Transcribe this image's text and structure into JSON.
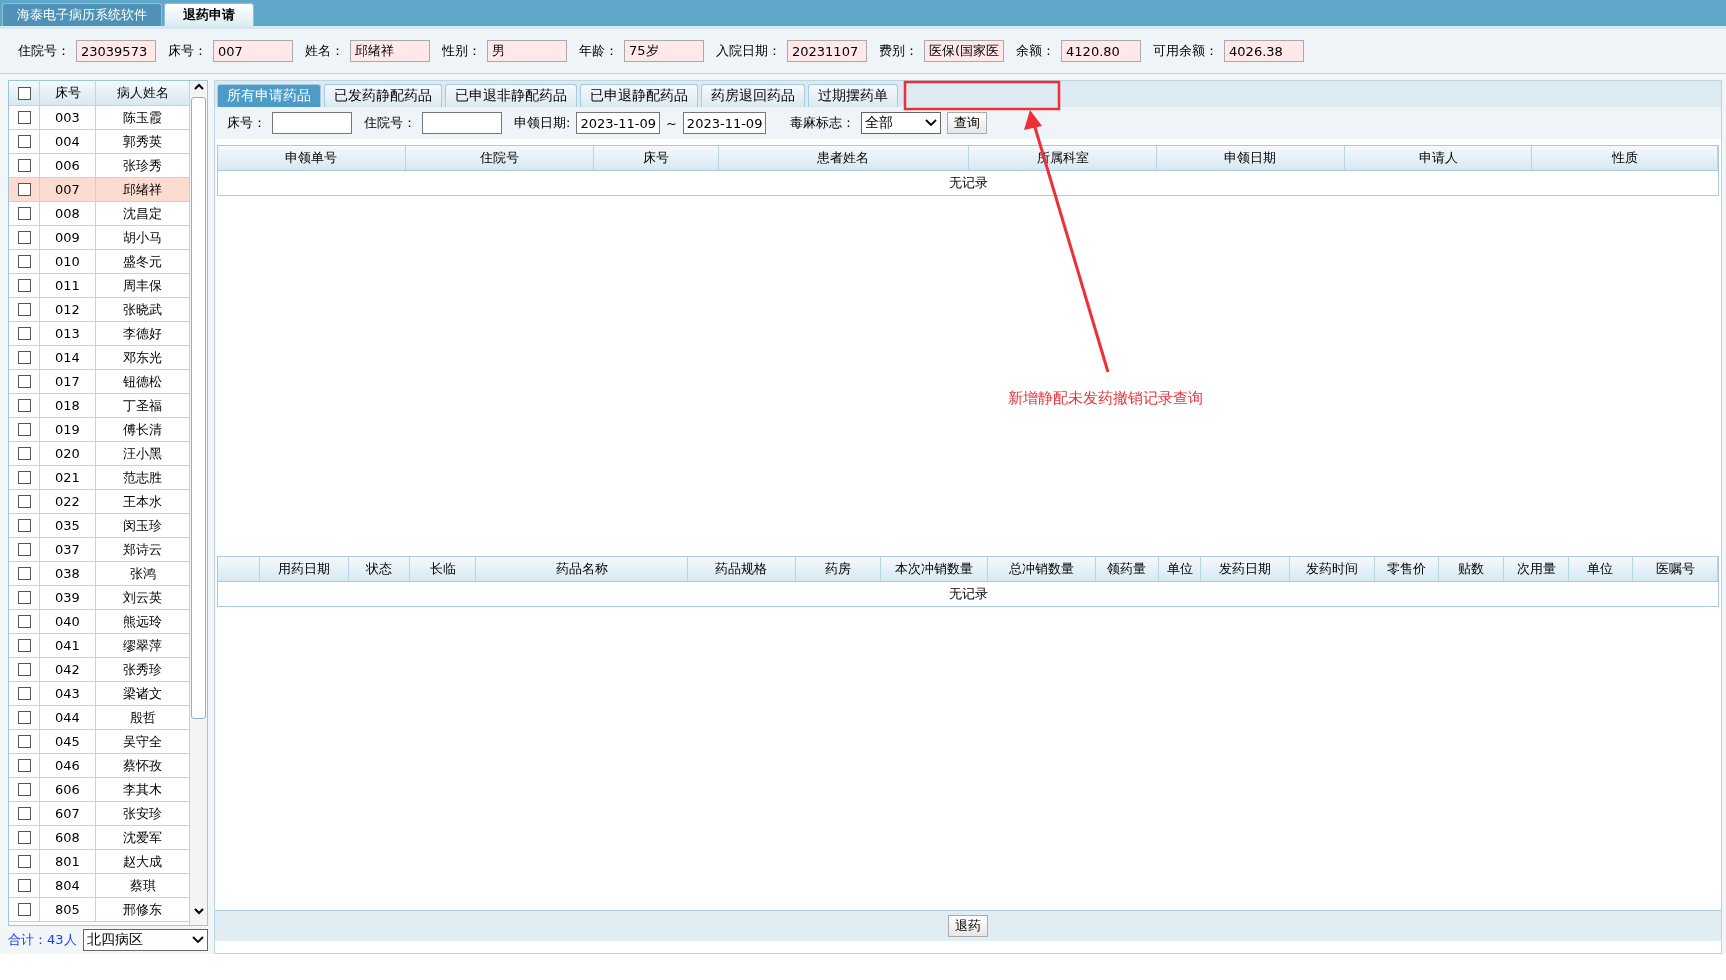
{
  "window_tabs": [
    {
      "label": "海泰电子病历系统软件",
      "selected": false
    },
    {
      "label": "退药申请",
      "selected": true
    }
  ],
  "patient_info": [
    {
      "label": "住院号：",
      "value": "23039573"
    },
    {
      "label": "床号：",
      "value": "007"
    },
    {
      "label": "姓名：",
      "value": "邱绪祥"
    },
    {
      "label": "性别：",
      "value": "男"
    },
    {
      "label": "年龄：",
      "value": "75岁"
    },
    {
      "label": "入院日期：",
      "value": "20231107"
    },
    {
      "label": "费别：",
      "value": "医保(国家医"
    },
    {
      "label": "余额：",
      "value": "4120.80"
    },
    {
      "label": "可用余额：",
      "value": "4026.38"
    }
  ],
  "patient_list": {
    "columns": [
      "床号",
      "病人姓名"
    ],
    "select_all_checked": false,
    "rows": [
      {
        "bed": "003",
        "name": "陈玉霞",
        "checked": false,
        "selected": false
      },
      {
        "bed": "004",
        "name": "郭秀英",
        "checked": false,
        "selected": false
      },
      {
        "bed": "006",
        "name": "张珍秀",
        "checked": false,
        "selected": false
      },
      {
        "bed": "007",
        "name": "邱绪祥",
        "checked": false,
        "selected": true
      },
      {
        "bed": "008",
        "name": "沈昌定",
        "checked": false,
        "selected": false
      },
      {
        "bed": "009",
        "name": "胡小马",
        "checked": false,
        "selected": false
      },
      {
        "bed": "010",
        "name": "盛冬元",
        "checked": false,
        "selected": false
      },
      {
        "bed": "011",
        "name": "周丰保",
        "checked": false,
        "selected": false
      },
      {
        "bed": "012",
        "name": "张晓武",
        "checked": false,
        "selected": false
      },
      {
        "bed": "013",
        "name": "李德好",
        "checked": false,
        "selected": false
      },
      {
        "bed": "014",
        "name": "邓东光",
        "checked": false,
        "selected": false
      },
      {
        "bed": "017",
        "name": "钮德松",
        "checked": false,
        "selected": false
      },
      {
        "bed": "018",
        "name": "丁圣福",
        "checked": false,
        "selected": false
      },
      {
        "bed": "019",
        "name": "傅长清",
        "checked": false,
        "selected": false
      },
      {
        "bed": "020",
        "name": "汪小黑",
        "checked": false,
        "selected": false
      },
      {
        "bed": "021",
        "name": "范志胜",
        "checked": false,
        "selected": false
      },
      {
        "bed": "022",
        "name": "王本水",
        "checked": false,
        "selected": false
      },
      {
        "bed": "035",
        "name": "闵玉珍",
        "checked": false,
        "selected": false
      },
      {
        "bed": "037",
        "name": "郑诗云",
        "checked": false,
        "selected": false
      },
      {
        "bed": "038",
        "name": "张鸿",
        "checked": false,
        "selected": false
      },
      {
        "bed": "039",
        "name": "刘云英",
        "checked": false,
        "selected": false
      },
      {
        "bed": "040",
        "name": "熊远玲",
        "checked": false,
        "selected": false
      },
      {
        "bed": "041",
        "name": "缪翠萍",
        "checked": false,
        "selected": false
      },
      {
        "bed": "042",
        "name": "张秀珍",
        "checked": false,
        "selected": false
      },
      {
        "bed": "043",
        "name": "梁诸文",
        "checked": false,
        "selected": false
      },
      {
        "bed": "044",
        "name": "殷哲",
        "checked": false,
        "selected": false
      },
      {
        "bed": "045",
        "name": "吴守全",
        "checked": false,
        "selected": false
      },
      {
        "bed": "046",
        "name": "蔡怀孜",
        "checked": false,
        "selected": false
      },
      {
        "bed": "606",
        "name": "李其木",
        "checked": false,
        "selected": false
      },
      {
        "bed": "607",
        "name": "张安珍",
        "checked": false,
        "selected": false
      },
      {
        "bed": "608",
        "name": "沈爱军",
        "checked": false,
        "selected": false
      },
      {
        "bed": "801",
        "name": "赵大成",
        "checked": false,
        "selected": false
      },
      {
        "bed": "804",
        "name": "蔡琪",
        "checked": false,
        "selected": false
      },
      {
        "bed": "805",
        "name": "邢修东",
        "checked": false,
        "selected": false
      }
    ],
    "total": "合计：43人",
    "ward": "北四病区"
  },
  "drug_tabs": [
    {
      "label": "所有申请药品",
      "selected": true
    },
    {
      "label": "已发药静配药品",
      "selected": false
    },
    {
      "label": "已申退非静配药品",
      "selected": false
    },
    {
      "label": "已申退静配药品",
      "selected": false
    },
    {
      "label": "药房退回药品",
      "selected": false
    },
    {
      "label": "过期摆药单",
      "selected": false
    }
  ],
  "filters": {
    "bed_label": "床号：",
    "inpatient_label": "住院号：",
    "date_label": "申领日期:",
    "date_from": "2023-11-09",
    "date_sep": "~",
    "date_to": "2023-11-09",
    "narcotic_label": "毒麻标志：",
    "narcotic_value": "全部",
    "query_button": "查询"
  },
  "requests_table": {
    "columns": [
      "申领单号",
      "住院号",
      "床号",
      "患者姓名",
      "所属科室",
      "申领日期",
      "申请人",
      "性质"
    ],
    "empty_text": "无记录"
  },
  "details_table": {
    "columns": [
      "用药日期",
      "状态",
      "长临",
      "药品名称",
      "药品规格",
      "药房",
      "本次冲销数量",
      "总冲销数量",
      "领药量",
      "单位",
      "发药日期",
      "发药时间",
      "零售价",
      "贴数",
      "次用量",
      "单位",
      "医嘱号"
    ],
    "empty_text": "无记录"
  },
  "return_button": "退药",
  "annotation": {
    "text": "新增静配未发药撤销记录查询"
  }
}
